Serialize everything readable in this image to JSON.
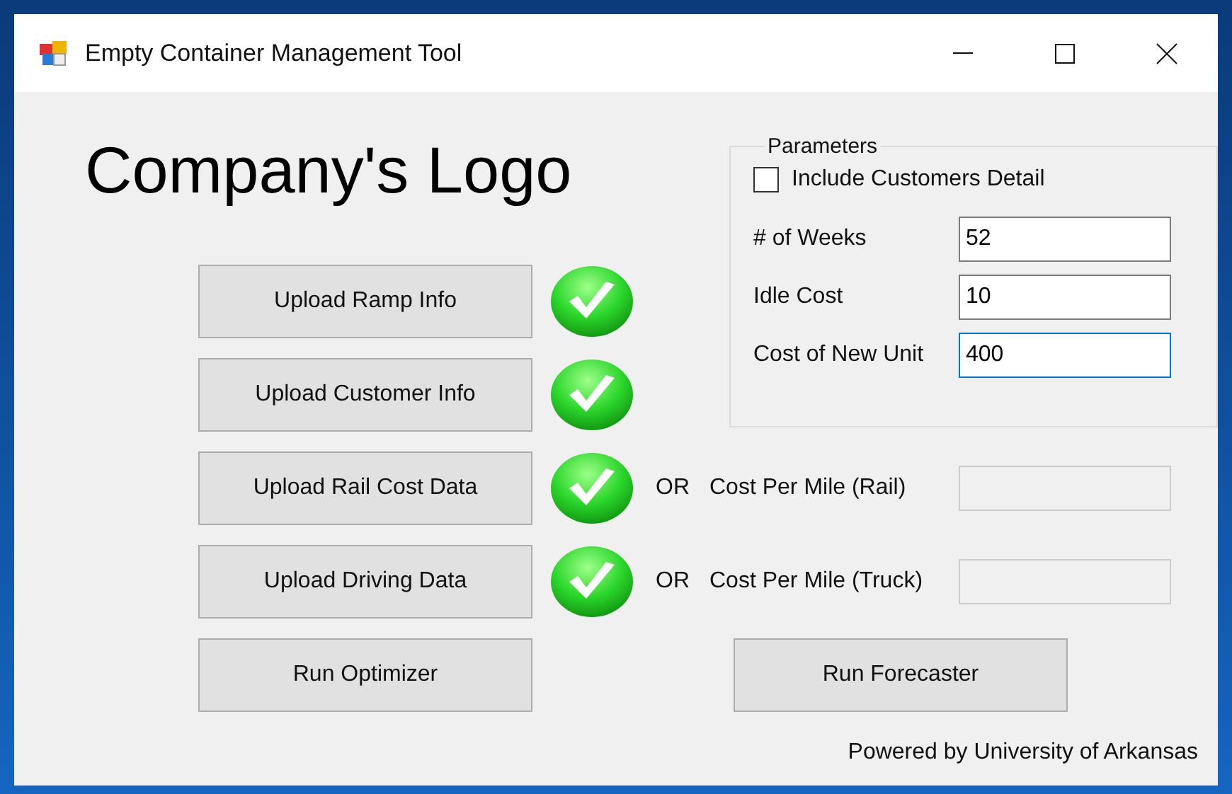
{
  "window": {
    "title": "Empty Container Management Tool"
  },
  "logo": "Company's Logo",
  "parameters": {
    "title": "Parameters",
    "include_customers": {
      "label": "Include Customers Detail",
      "checked": false
    },
    "fields": [
      {
        "label": "# of Weeks",
        "value": "52",
        "focused": false
      },
      {
        "label": "Idle Cost",
        "value": "10",
        "focused": false
      },
      {
        "label": "Cost of New Unit",
        "value": "400",
        "focused": true
      }
    ]
  },
  "uploads": [
    {
      "label": "Upload Ramp Info",
      "done": true
    },
    {
      "label": "Upload Customer Info",
      "done": true
    },
    {
      "label": "Upload Rail Cost Data",
      "done": true,
      "alternative": {
        "or": "OR",
        "label": "Cost Per Mile (Rail)",
        "disabled": true
      }
    },
    {
      "label": "Upload Driving Data",
      "done": true,
      "alternative": {
        "or": "OR",
        "label": "Cost Per Mile (Truck)",
        "disabled": true
      }
    }
  ],
  "actions": [
    "Run Optimizer",
    "Run Forecaster"
  ],
  "footer": "Powered by University of Arkansas"
}
